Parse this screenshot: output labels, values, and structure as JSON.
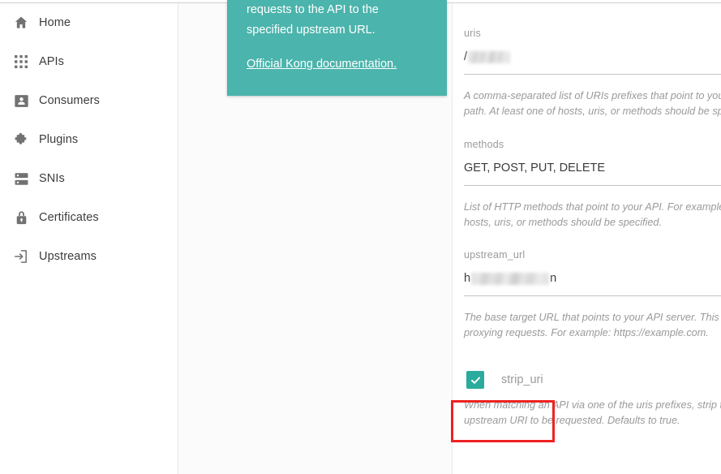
{
  "sidebar": {
    "items": [
      {
        "label": "Home",
        "icon": "home-icon"
      },
      {
        "label": "APIs",
        "icon": "apps-grid-icon"
      },
      {
        "label": "Consumers",
        "icon": "contact-card-icon"
      },
      {
        "label": "Plugins",
        "icon": "puzzle-piece-icon"
      },
      {
        "label": "SNIs",
        "icon": "server-icon"
      },
      {
        "label": "Certificates",
        "icon": "lock-icon"
      },
      {
        "label": "Upstreams",
        "icon": "arrow-into-box-icon"
      }
    ]
  },
  "info_card": {
    "body": "requests to the API to the specified upstream URL.",
    "link_label": "Official Kong documentation.",
    "background_color": "#4bb4ac"
  },
  "form": {
    "fields": [
      {
        "name": "uris",
        "label": "uris",
        "value_prefix": "/",
        "value_suffix": "",
        "redacted": true,
        "help": "A comma-separated list of URIs prefixes that point to your API. For example: /my-path. At least one of hosts, uris, or methods should be specified."
      },
      {
        "name": "methods",
        "label": "methods",
        "value": "GET, POST, PUT, DELETE",
        "redacted": false,
        "help": "List of HTTP methods that point to your API. For example: GET,POST. At least one of hosts, uris, or methods should be specified."
      },
      {
        "name": "upstream_url",
        "label": "upstream_url",
        "value_prefix": "h",
        "value_suffix": "n",
        "redacted": true,
        "help": "The base target URL that points to your API server. This URL will be used for proxying requests. For example: https://example.com."
      }
    ],
    "checkbox": {
      "name": "strip_uri",
      "label": "strip_uri",
      "checked": true,
      "accent_color": "#2bab9e",
      "help": "When matching an API via one of the uris prefixes, strip that matching prefix from the upstream URI to be requested. Defaults to true."
    }
  },
  "annotation": {
    "color": "#ee2222",
    "target": "strip_uri-checkbox"
  }
}
